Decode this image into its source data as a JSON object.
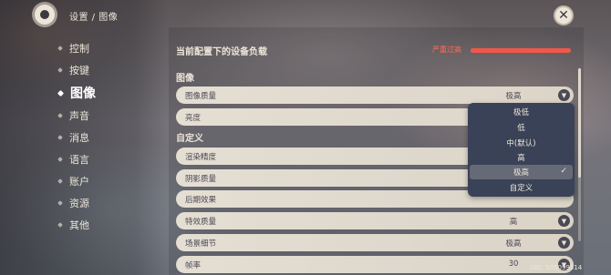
{
  "header": {
    "breadcrumb": "设置 / 图像",
    "close_symbol": "✕"
  },
  "sidebar": {
    "items": [
      {
        "label": "控制",
        "active": false
      },
      {
        "label": "按键",
        "active": false
      },
      {
        "label": "图像",
        "active": true
      },
      {
        "label": "声音",
        "active": false
      },
      {
        "label": "消息",
        "active": false
      },
      {
        "label": "语言",
        "active": false
      },
      {
        "label": "账户",
        "active": false
      },
      {
        "label": "资源",
        "active": false
      },
      {
        "label": "其他",
        "active": false
      }
    ]
  },
  "device_load": {
    "title": "当前配置下的设备负载",
    "status": "严重过高",
    "level": 1.0,
    "color": "#f0584a"
  },
  "sections": {
    "image": "图像",
    "custom": "自定义"
  },
  "rows": {
    "graphics_quality": {
      "label": "图像质量",
      "value": "极高"
    },
    "brightness": {
      "label": "亮度",
      "value": ""
    },
    "render_resolution": {
      "label": "渲染精度",
      "value": ""
    },
    "shadow_quality": {
      "label": "阴影质量",
      "value": ""
    },
    "post_processing": {
      "label": "后期效果",
      "value": ""
    },
    "sfx_quality": {
      "label": "特效质量",
      "value": "高"
    },
    "scene_detail": {
      "label": "场景细节",
      "value": "极高"
    },
    "frame_rate": {
      "label": "帧率",
      "value": "30"
    }
  },
  "dropdown": {
    "options": [
      "极低",
      "低",
      "中(默认)",
      "高",
      "极高",
      "自定义"
    ],
    "selected": "极高",
    "check_symbol": "✓"
  },
  "footer": {
    "uid": "UID: 505099314"
  },
  "icons": {
    "settings": "gear-icon",
    "close": "close-icon",
    "arrow": "chevron-down-icon"
  }
}
